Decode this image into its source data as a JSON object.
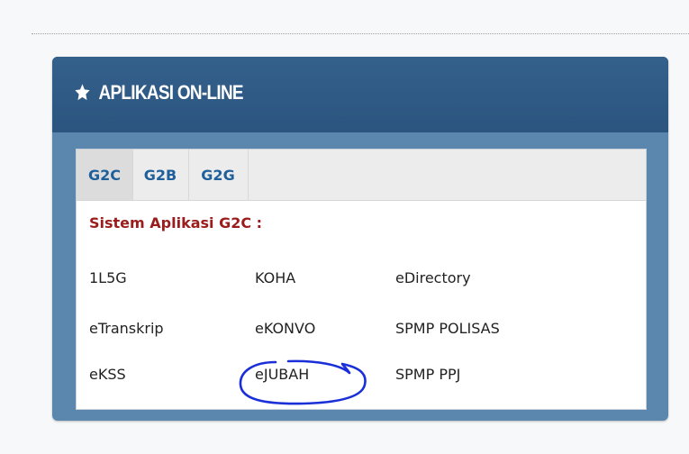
{
  "widget": {
    "title": "APLIKASI ON-LINE",
    "title_icon": "star-icon",
    "header_color": "#2f5a86",
    "frame_color": "#5b87ae"
  },
  "tabs": [
    {
      "label": "G2C",
      "active": true
    },
    {
      "label": "G2B",
      "active": false
    },
    {
      "label": "G2G",
      "active": false
    }
  ],
  "section": {
    "heading": "Sistem Aplikasi G2C :",
    "heading_color": "#9b1c1c"
  },
  "apps": [
    [
      "1L5G",
      "KOHA",
      "eDirectory"
    ],
    [
      "eTranskrip",
      "eKONVO",
      "SPMP POLISAS"
    ],
    [
      "eKSS",
      "eJUBAH",
      "SPMP PPJ"
    ]
  ],
  "annotation": {
    "type": "hand-drawn circle",
    "target": "eJUBAH",
    "color": "#1a2fd8"
  }
}
